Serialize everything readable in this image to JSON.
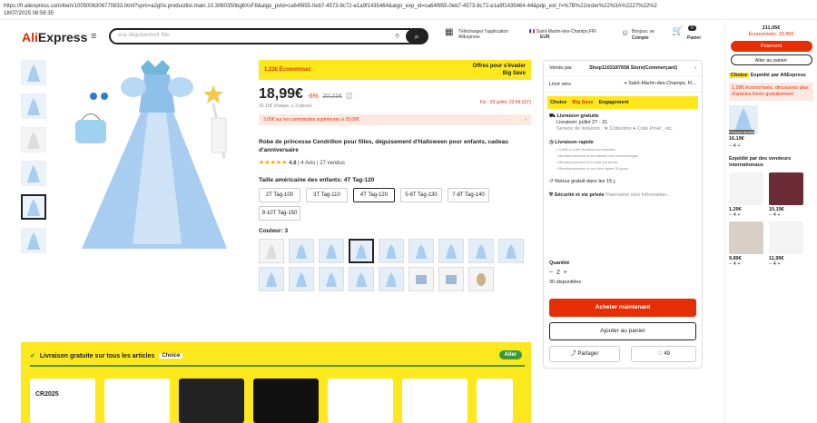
{
  "browser": {
    "url": "https://fr.aliexpress.com/item/1005006306770833.html?spm=a2g0o.productlist.main.10.3060350bg6XvF8&algo_pvid=ca64f855-0eb7-4573-8c72-e1a9f1435464&algo_exp_id=ca64f855-0eb7-4573-8c72-e1a9f1435464-44&pdp_ext_f=%7B%22order%22%3A%2227%22%2",
    "datetime": "18/07/2025 08:56:35"
  },
  "header": {
    "logo_a": "Ali",
    "logo_b": "Express",
    "search_placeholder": "eva déguisement fille",
    "app_label": "Téléchargez l'application AliExpress",
    "ship_to": "Saint-Martin-des-Champs,FR/",
    "currency": "EUR",
    "account_line1": "Bonjour, se",
    "account_line2": "Compte",
    "cart_label": "Panier",
    "cart_count": "0"
  },
  "product": {
    "promo_left": "1,22€ Économisez",
    "promo_right_1": "Offres pour s'évader",
    "promo_right_2": "Big Save",
    "price": "18,99€",
    "discount": "-6%",
    "old_price": "20,21€",
    "unit_price": "16,19€ chaque, ≥ 3 pièces",
    "date_info": "Fin : 20 juillet, 23:59 (GT)",
    "coupon": "3,00€ sur les commandes supérieures à 29,00€",
    "title": "Robe de princesse Cendrillon pour filles, déguisement d'Halloween pour enfants, cadeau d'anniversaire",
    "rating": "4.8",
    "reviews": "4 Avis",
    "sold": "27 vendus",
    "size_label": "Taille américaine des enfants: 4T Tag-120",
    "sizes": [
      "2T Tag-100",
      "3T Tag-110",
      "4T Tag-120",
      "5-6T Tag-130",
      "7-8T Tag-140",
      "9-10T Tag-150"
    ],
    "color_label": "Couleur: 3"
  },
  "buybox": {
    "seller_label": "Vendu par",
    "seller": "Shop1103187658 Store(Commerçant)",
    "deliver_label": "Livré vers",
    "deliver_to": "Saint-Martin-des-Champs, Fl...",
    "choice": "Choice",
    "bigsave": "Big Save",
    "engagement": "Engagement",
    "free_title": "Livraison gratuite",
    "free_date": "Livraison: juillet 27 - 31",
    "service": "Service de livraison : ★ Colissimo ● Colis Privé , etc.",
    "fast_title": "Livraison rapide",
    "fast_1": "• 3,00€ si votre livraison est retardée",
    "fast_2": "• Remboursement si les articles sont endommagés",
    "fast_3": "• Remboursement si le colis est perdu",
    "fast_4": "• Remboursement si non livré après 30 jours",
    "return": "Retour gratuit dans les 15 j.",
    "security": "Sécurité et vie privée",
    "security_sub": "Paiements sûrs Information...",
    "qty_label": "Quantité",
    "qty": "2",
    "available": "30 disponibles",
    "buy_now": "Acheter maintenant",
    "add_cart": "Ajouter au panier",
    "share": "Partager",
    "fav_count": "49"
  },
  "sidebar": {
    "total": "211,05€",
    "savings": "Économisés: 33,88€",
    "pay": "Paiement",
    "cart": "Aller au panier",
    "choice_badge": "Choice",
    "shipped_by": "Expédié par AliExpress",
    "promo_text": "1,99€ économisés, découvrez plus d'articles livrés gratuitement",
    "item_tag": "Presque épuisé",
    "item_price": "16,19€",
    "item_qty": "4",
    "intl_title": "Expédié par des vendeurs internationaux",
    "prices": [
      "1,29€",
      "10,19€",
      "9,89€",
      "11,99€"
    ],
    "qtys": [
      "4",
      "4",
      "4",
      "4"
    ]
  },
  "banner": {
    "title": "Livraison gratuite sur tous les articles",
    "badge": "Choice",
    "go": "Aller",
    "tile1": "CR2025"
  },
  "colors": {
    "accent": "#e62e04",
    "yellow": "#fde81e",
    "dress": "#a9cdf0"
  }
}
